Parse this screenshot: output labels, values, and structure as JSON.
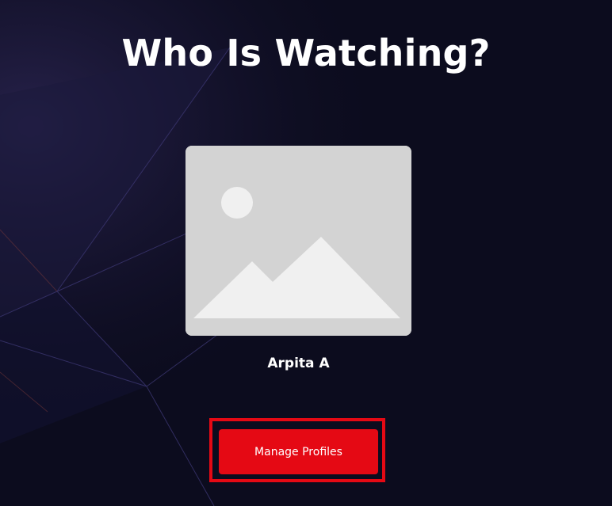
{
  "page": {
    "title": "Who Is Watching?"
  },
  "profiles": [
    {
      "name": "Arpita A",
      "avatar_icon": "image-placeholder-icon"
    }
  ],
  "actions": {
    "manage_profiles_label": "Manage Profiles"
  },
  "colors": {
    "background": "#0c0c1e",
    "accent": "#e50914",
    "text": "#ffffff",
    "placeholder": "#d3d3d3"
  }
}
